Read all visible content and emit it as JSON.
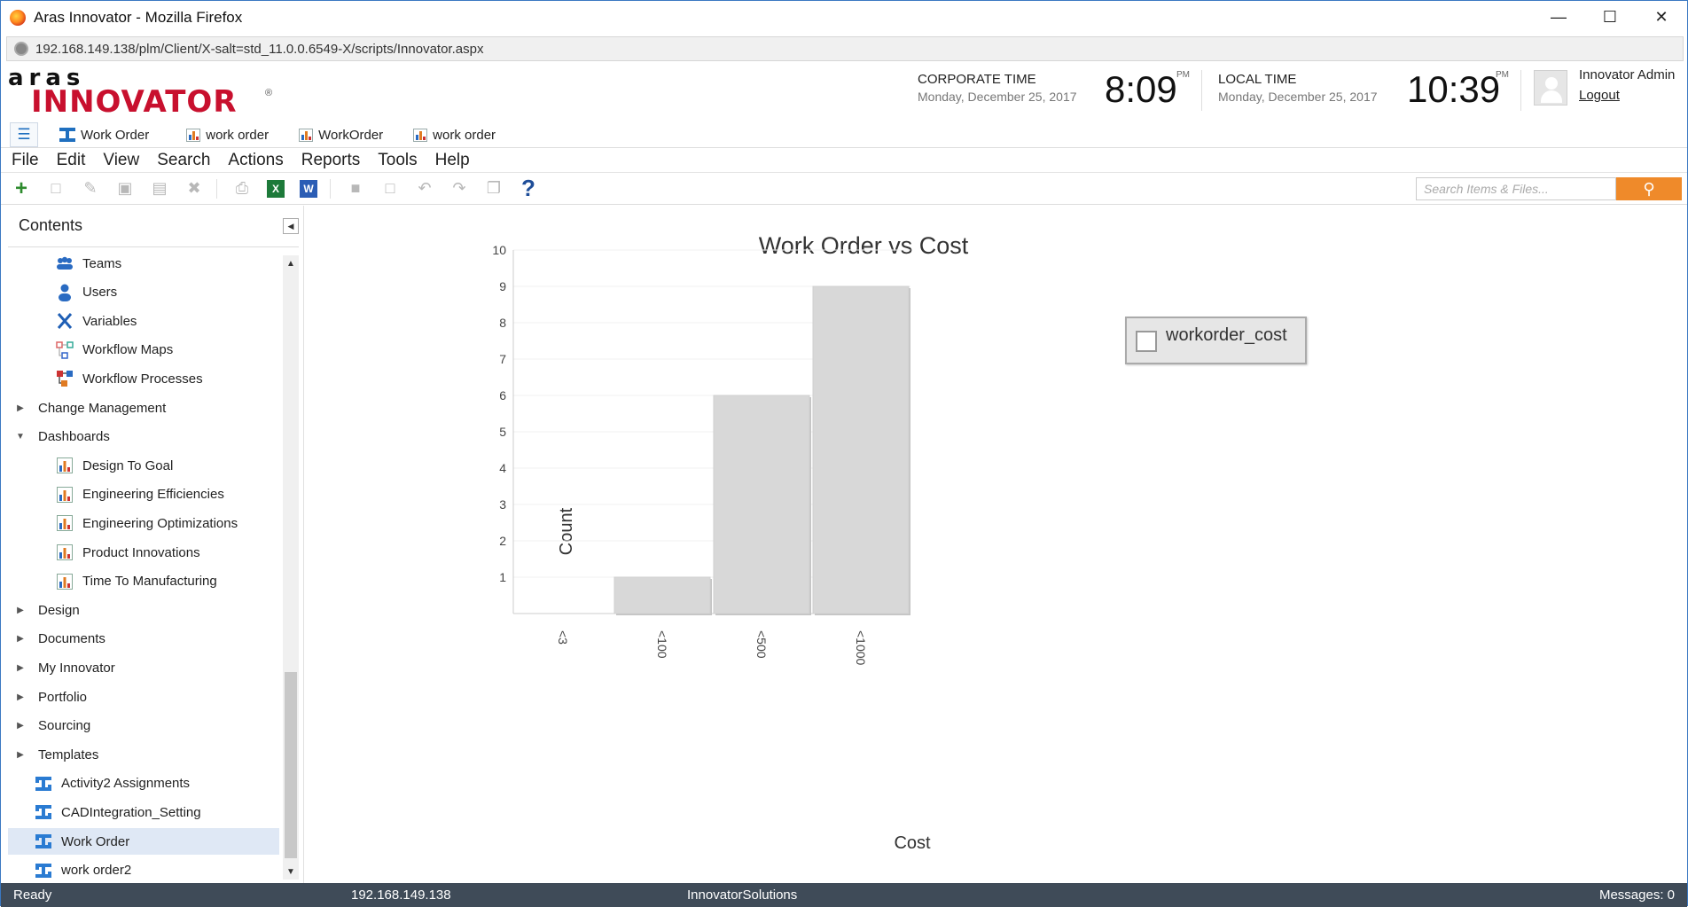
{
  "window": {
    "title": "Aras Innovator - Mozilla Firefox",
    "url": "192.168.149.138/plm/Client/X-salt=std_11.0.0.6549-X/scripts/Innovator.aspx"
  },
  "header": {
    "logo_top": "aras",
    "logo_bottom": "INNOVATOR",
    "logo_reg": "®",
    "corporate_label": "CORPORATE TIME",
    "corporate_date": "Monday, December 25, 2017",
    "corporate_time": "8:09",
    "corporate_ampm": "PM",
    "local_label": "LOCAL TIME",
    "local_date": "Monday, December 25, 2017",
    "local_time": "10:39",
    "local_ampm": "PM",
    "user_name": "Innovator Admin",
    "logout": "Logout"
  },
  "tabs": [
    {
      "label": "Work Order",
      "icon": "itemtype-icon"
    },
    {
      "label": "work order",
      "icon": "dashboard-chart-icon"
    },
    {
      "label": "WorkOrder",
      "icon": "dashboard-chart-icon"
    },
    {
      "label": "work order",
      "icon": "dashboard-chart-icon"
    }
  ],
  "menu": [
    "File",
    "Edit",
    "View",
    "Search",
    "Actions",
    "Reports",
    "Tools",
    "Help"
  ],
  "toolbar": {
    "search_placeholder": "Search Items & Files..."
  },
  "sidebar": {
    "title": "Contents",
    "items": [
      {
        "label": "Teams",
        "level": 1,
        "icon": "teams-icon"
      },
      {
        "label": "Users",
        "level": 1,
        "icon": "user-icon"
      },
      {
        "label": "Variables",
        "level": 1,
        "icon": "variable-x-icon"
      },
      {
        "label": "Workflow Maps",
        "level": 1,
        "icon": "workflow-map-icon"
      },
      {
        "label": "Workflow Processes",
        "level": 1,
        "icon": "workflow-process-icon"
      },
      {
        "label": "Change Management",
        "level": 0,
        "expanded": false
      },
      {
        "label": "Dashboards",
        "level": 0,
        "expanded": true
      },
      {
        "label": "Design To Goal",
        "level": 1,
        "icon": "dashboard-chart-icon"
      },
      {
        "label": "Engineering Efficiencies",
        "level": 1,
        "icon": "dashboard-chart-icon"
      },
      {
        "label": "Engineering Optimizations",
        "level": 1,
        "icon": "dashboard-chart-icon"
      },
      {
        "label": "Product Innovations",
        "level": 1,
        "icon": "dashboard-chart-icon"
      },
      {
        "label": "Time To Manufacturing",
        "level": 1,
        "icon": "dashboard-chart-icon"
      },
      {
        "label": "Design",
        "level": 0,
        "expanded": false
      },
      {
        "label": "Documents",
        "level": 0,
        "expanded": false
      },
      {
        "label": "My Innovator",
        "level": 0,
        "expanded": false
      },
      {
        "label": "Portfolio",
        "level": 0,
        "expanded": false
      },
      {
        "label": "Sourcing",
        "level": 0,
        "expanded": false
      },
      {
        "label": "Templates",
        "level": 0,
        "expanded": false
      },
      {
        "label": "Activity2 Assignments",
        "level": 0,
        "icon": "itemtype-icon"
      },
      {
        "label": "CADIntegration_Setting",
        "level": 0,
        "icon": "itemtype-icon"
      },
      {
        "label": "Work Order",
        "level": 0,
        "icon": "itemtype-icon",
        "selected": true
      },
      {
        "label": "work order2",
        "level": 0,
        "icon": "itemtype-icon"
      }
    ]
  },
  "chart_data": {
    "type": "bar",
    "title": "Work Order vs Cost",
    "xlabel": "Cost",
    "ylabel": "Count",
    "categories": [
      "<3",
      "<100",
      "<500",
      "<1000"
    ],
    "series": [
      {
        "name": "workorder_cost",
        "values": [
          0,
          1,
          6,
          9
        ]
      }
    ],
    "ylim": [
      0,
      10
    ],
    "yticks": [
      1,
      2,
      3,
      4,
      5,
      6,
      7,
      8,
      9,
      10
    ],
    "bar_color": "#d8d8d8",
    "grid": true,
    "legend": "top-right"
  },
  "status": {
    "left": "Ready",
    "host": "192.168.149.138",
    "db": "InnovatorSolutions",
    "messages": "Messages:  0"
  }
}
